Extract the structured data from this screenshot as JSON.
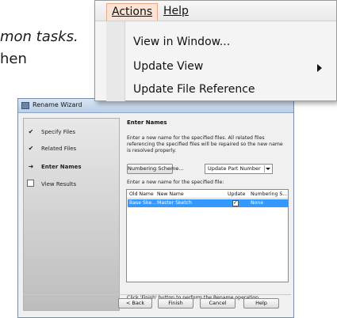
{
  "background_doc": {
    "line1": "mon tasks.",
    "line2": "hen"
  },
  "menu": {
    "bar_items": [
      "Actions",
      "Help"
    ],
    "items": [
      {
        "label": "View in Window..."
      },
      {
        "label": "Update View",
        "has_submenu": true
      },
      {
        "label": "Update File Reference"
      }
    ]
  },
  "wizard": {
    "title": "Rename Wizard",
    "steps": [
      {
        "label": "Specify Files",
        "state": "done",
        "mark": "✔"
      },
      {
        "label": "Related Files",
        "state": "done",
        "mark": "✔"
      },
      {
        "label": "Enter Names",
        "state": "current",
        "mark": "➜"
      },
      {
        "label": "View Results",
        "state": "pending"
      }
    ],
    "heading": "Enter Names",
    "description": "Enter a new name for the specified files.  All related files referencing the specified files will be repaired so the new name is resolved properly.",
    "numbering_button": "Numbering Scheme...",
    "dropdown_value": "Update Part Number",
    "grid_label": "Enter a new name for the specified file:",
    "grid": {
      "columns": [
        "Old Name",
        "New Name",
        "Update",
        "Numbering S..."
      ],
      "rows": [
        {
          "old_name": "Base Ske...",
          "new_name": "Master Sketch",
          "update": true,
          "numbering": "None"
        }
      ]
    },
    "footer_text": "Click 'Finish' button to perform the Rename operation",
    "buttons": {
      "back": "< Back",
      "finish": "Finish",
      "cancel": "Cancel",
      "help": "Help"
    }
  }
}
